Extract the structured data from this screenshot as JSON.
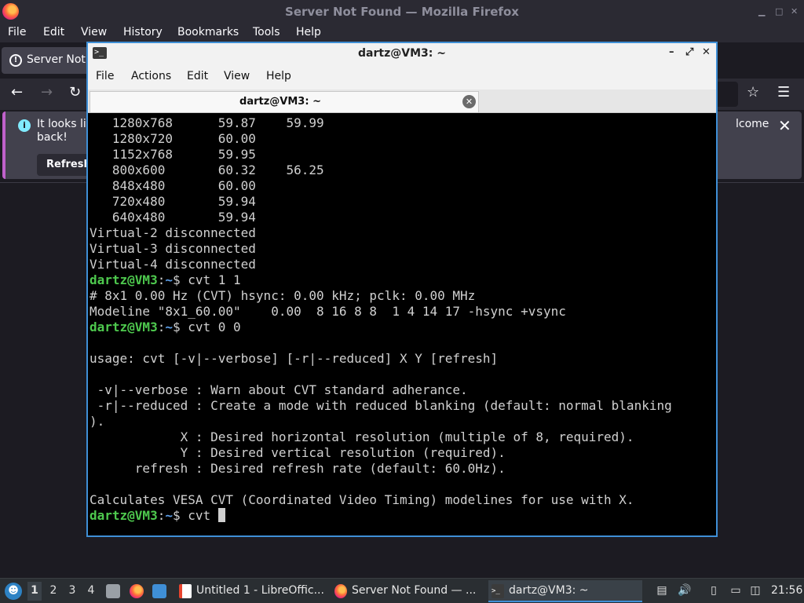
{
  "firefox": {
    "title": "Server Not Found — Mozilla Firefox",
    "menu": [
      "File",
      "Edit",
      "View",
      "History",
      "Bookmarks",
      "Tools",
      "Help"
    ],
    "tab_label": "Server Not F",
    "notification": {
      "text_line1": "It looks lik",
      "text_line2": "back!",
      "text_right": "lcome",
      "refresh_label": "Refresh"
    }
  },
  "terminal": {
    "title": "dartz@VM3: ~",
    "menu": [
      "File",
      "Actions",
      "Edit",
      "View",
      "Help"
    ],
    "tab_label": "dartz@VM3: ~",
    "prompt_user": "dartz@VM3",
    "prompt_sep": ":",
    "prompt_path": "~",
    "prompt_end": "$ ",
    "lines": [
      {
        "text": "   1280x768      59.87    59.99"
      },
      {
        "text": "   1280x720      60.00"
      },
      {
        "text": "   1152x768      59.95"
      },
      {
        "text": "   800x600       60.32    56.25"
      },
      {
        "text": "   848x480       60.00"
      },
      {
        "text": "   720x480       59.94"
      },
      {
        "text": "   640x480       59.94"
      },
      {
        "text": "Virtual-2 disconnected"
      },
      {
        "text": "Virtual-3 disconnected"
      },
      {
        "text": "Virtual-4 disconnected"
      },
      {
        "prompt": true,
        "cmd": "cvt 1 1"
      },
      {
        "text": "# 8x1 0.00 Hz (CVT) hsync: 0.00 kHz; pclk: 0.00 MHz"
      },
      {
        "text": "Modeline \"8x1_60.00\"    0.00  8 16 8 8  1 4 14 17 -hsync +vsync"
      },
      {
        "prompt": true,
        "cmd": "cvt 0 0"
      },
      {
        "text": ""
      },
      {
        "text": "usage: cvt [-v|--verbose] [-r|--reduced] X Y [refresh]"
      },
      {
        "text": ""
      },
      {
        "text": " -v|--verbose : Warn about CVT standard adherance."
      },
      {
        "text": " -r|--reduced : Create a mode with reduced blanking (default: normal blanking"
      },
      {
        "text": ")."
      },
      {
        "text": "            X : Desired horizontal resolution (multiple of 8, required)."
      },
      {
        "text": "            Y : Desired vertical resolution (required)."
      },
      {
        "text": "      refresh : Desired refresh rate (default: 60.0Hz)."
      },
      {
        "text": ""
      },
      {
        "text": "Calculates VESA CVT (Coordinated Video Timing) modelines for use with X."
      },
      {
        "prompt": true,
        "cmd": "cvt ",
        "cursor": true
      }
    ]
  },
  "taskbar": {
    "workspaces": [
      "1",
      "2",
      "3",
      "4"
    ],
    "active_workspace": "1",
    "tasks": [
      {
        "label": "Untitled 1 - LibreOffic...",
        "icon": "libreoffice-writer-icon"
      },
      {
        "label": "Server Not Found — ...",
        "icon": "firefox-icon"
      },
      {
        "label": "dartz@VM3: ~",
        "icon": "terminal-icon"
      }
    ],
    "clock": "21:56"
  },
  "colors": {
    "accent": "#3f8fd6",
    "prompt_user": "#4ec94e",
    "prompt_path": "#5c9ee8"
  }
}
